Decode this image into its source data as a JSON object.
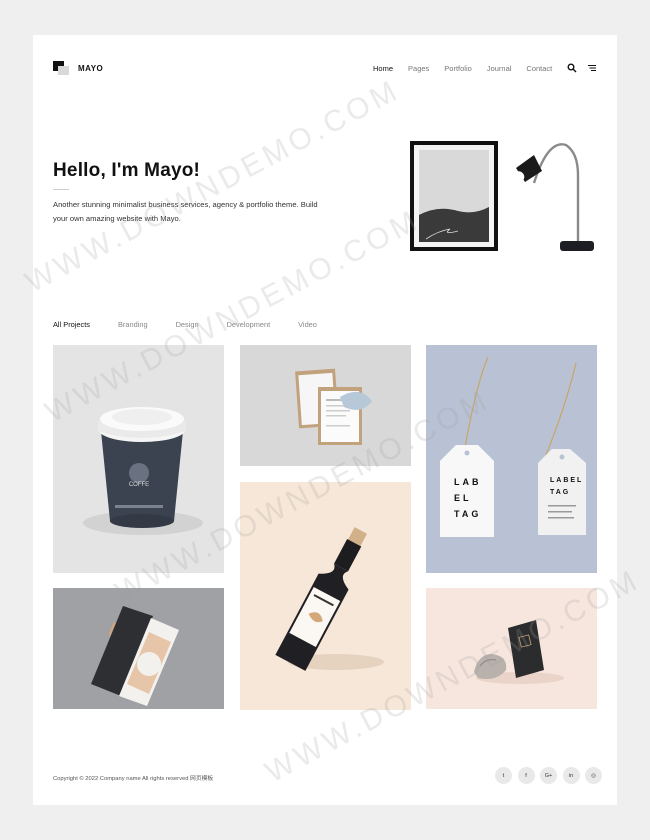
{
  "brand": {
    "name": "MAYO"
  },
  "nav": {
    "items": [
      "Home",
      "Pages",
      "Portfolio",
      "Journal",
      "Contact"
    ],
    "active": "Home",
    "icons": [
      "search-icon",
      "menu-icon"
    ]
  },
  "hero": {
    "title": "Hello, I'm Mayo!",
    "text": "Another stunning minimalist business services, agency & portfolio theme. Build your own amazing website with Mayo."
  },
  "filters": {
    "items": [
      "All Projects",
      "Branding",
      "Design",
      "Development",
      "Video"
    ],
    "active": "All Projects"
  },
  "portfolio": {
    "tiles": [
      {
        "subject": "coffee cup",
        "text_lines": [
          "COFFE"
        ],
        "bg": "#e4e4e4"
      },
      {
        "subject": "clipboards",
        "bg": "#d8d8d8"
      },
      {
        "subject": "label tags",
        "text_lines": [
          "LAB",
          "EL",
          "TAG",
          "LABEL",
          "TAG"
        ],
        "bg": "#b8c2d4"
      },
      {
        "subject": "wine bottle",
        "bg": "#f6e7d8"
      },
      {
        "subject": "brochure",
        "bg": "#9fa1a5"
      },
      {
        "subject": "book and stone",
        "bg": "#f7e6de"
      }
    ]
  },
  "footer": {
    "copyright": "Copyright © 2022 Company name All rights reserved 网页模板",
    "social": [
      "twitter-icon",
      "facebook-icon",
      "google-plus-icon",
      "linkedin-icon",
      "dribbble-icon"
    ],
    "social_labels": [
      "t",
      "f",
      "G+",
      "in",
      "◎"
    ]
  },
  "watermark": "WWW.DOWNDEMO.COM"
}
